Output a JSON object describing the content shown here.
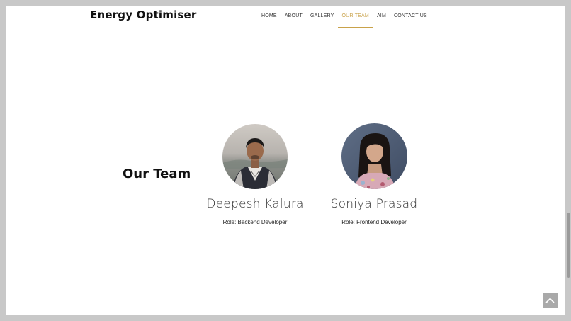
{
  "header": {
    "brand": "Energy Optimiser",
    "nav": [
      {
        "label": "HOME",
        "active": false
      },
      {
        "label": "ABOUT",
        "active": false
      },
      {
        "label": "GALLERY",
        "active": false
      },
      {
        "label": "OUR TEAM",
        "active": true
      },
      {
        "label": "AIM",
        "active": false
      },
      {
        "label": "CONTACT US",
        "active": false
      }
    ]
  },
  "team": {
    "title": "Our Team",
    "members": [
      {
        "name": "Deepesh Kalura",
        "role": "Role: Backend Developer"
      },
      {
        "name": "Soniya Prasad",
        "role": "Role: Frontend Developer"
      }
    ]
  },
  "colors": {
    "accent": "#c9a24a",
    "background": "#ffffff",
    "outer": "#c8c8c8"
  },
  "icons": {
    "scroll_top": "chevron-up-icon"
  }
}
